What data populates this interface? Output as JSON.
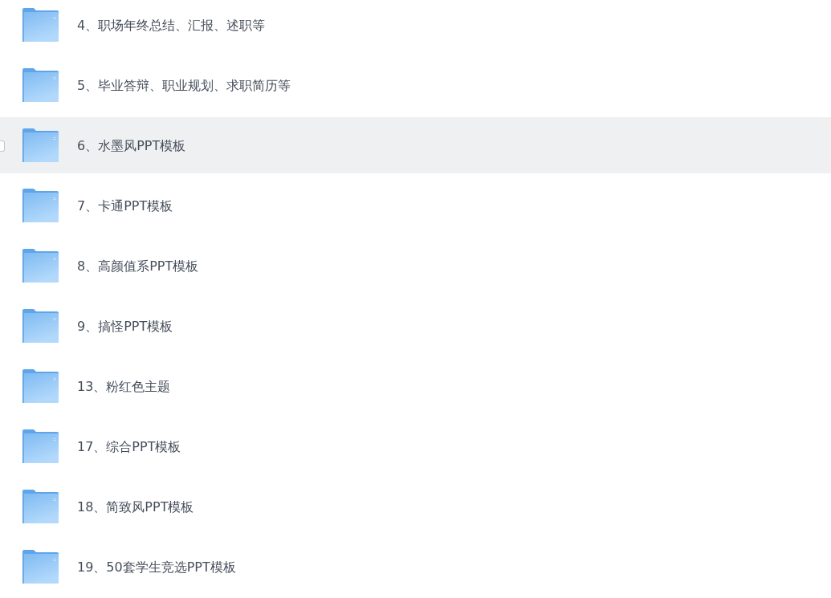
{
  "files": [
    {
      "name": "4、职场年终总结、汇报、述职等",
      "highlighted": false,
      "checked": false
    },
    {
      "name": "5、毕业答辩、职业规划、求职简历等",
      "highlighted": false,
      "checked": false
    },
    {
      "name": "6、水墨风PPT模板",
      "highlighted": true,
      "checked": false
    },
    {
      "name": "7、卡通PPT模板",
      "highlighted": false,
      "checked": false
    },
    {
      "name": "8、高颜值系PPT模板",
      "highlighted": false,
      "checked": false
    },
    {
      "name": "9、搞怪PPT模板",
      "highlighted": false,
      "checked": false
    },
    {
      "name": "13、粉红色主题",
      "highlighted": false,
      "checked": false
    },
    {
      "name": "17、综合PPT模板",
      "highlighted": false,
      "checked": false
    },
    {
      "name": "18、简致风PPT模板",
      "highlighted": false,
      "checked": false
    },
    {
      "name": "19、50套学生竞选PPT模板",
      "highlighted": false,
      "checked": false
    }
  ]
}
